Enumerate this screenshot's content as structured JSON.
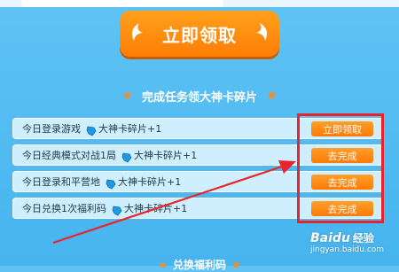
{
  "claim_button": {
    "label": "立即领取"
  },
  "section": {
    "title": "完成任务领大神卡碎片",
    "star_icon": "star-icon"
  },
  "tasks": [
    {
      "name": "今日登录游戏",
      "reward": "大神卡碎片+1",
      "action": "立即领取"
    },
    {
      "name": "今日经典模式对战1局",
      "reward": "大神卡碎片+1",
      "action": "去完成"
    },
    {
      "name": "今日登录和平营地",
      "reward": "大神卡碎片+1",
      "action": "去完成"
    },
    {
      "name": "今日兑换1次福利码",
      "reward": "大神卡碎片+1",
      "action": "去完成"
    }
  ],
  "bottom_section": {
    "title": "兑换福利码"
  },
  "watermark": {
    "logo": "Baidu",
    "product": "经验",
    "url": "jingyan.baidu.com"
  },
  "colors": {
    "background": "#4fb9f1",
    "button_orange": "#ff8a12",
    "highlight_red": "#e8252c",
    "row_background": "#cfeefe"
  }
}
